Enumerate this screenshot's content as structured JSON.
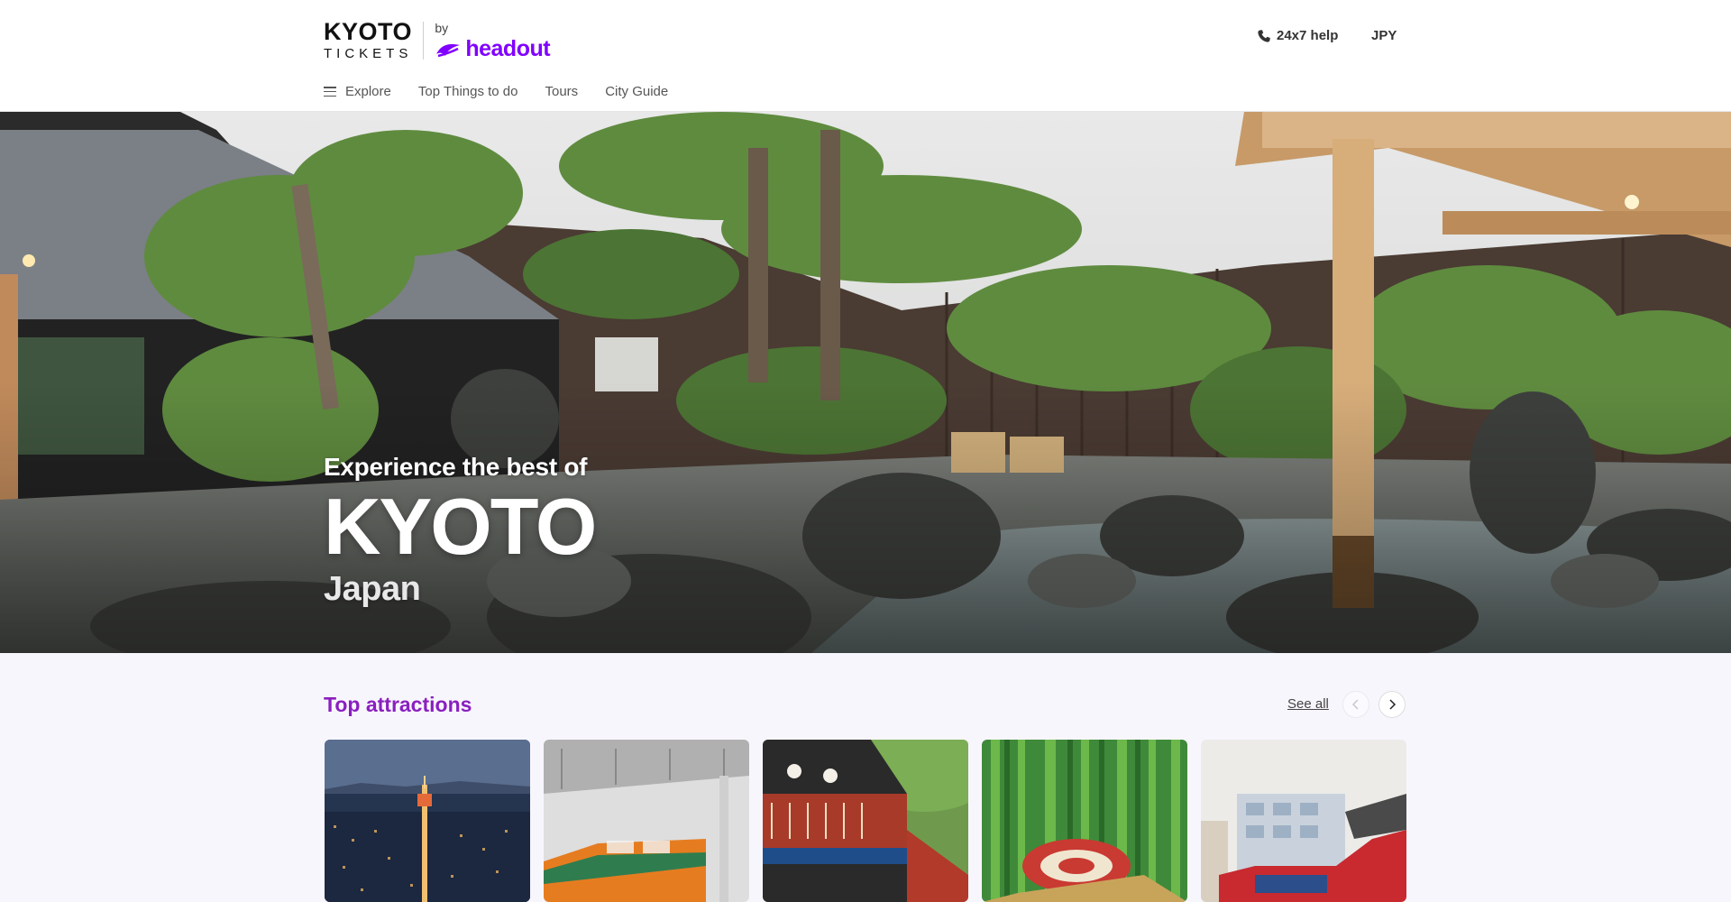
{
  "header": {
    "logo_city": "KYOTO",
    "logo_tickets": "TICKETS",
    "logo_by": "by",
    "logo_brand": "headout",
    "help_label": "24x7 help",
    "currency": "JPY"
  },
  "nav": {
    "items": [
      {
        "label": "Explore",
        "icon": "menu-icon"
      },
      {
        "label": "Top Things to do"
      },
      {
        "label": "Tours"
      },
      {
        "label": "City Guide"
      }
    ]
  },
  "hero": {
    "subtitle": "Experience the best of",
    "title": "KYOTO",
    "country": "Japan"
  },
  "attractions": {
    "title": "Top attractions",
    "see_all": "See all",
    "cards": [
      {
        "image": "kyoto-tower-night"
      },
      {
        "image": "train-station"
      },
      {
        "image": "red-building"
      },
      {
        "image": "bamboo-umbrella"
      },
      {
        "image": "sightseeing-bus"
      }
    ]
  },
  "colors": {
    "brand": "#8000ff",
    "section_title": "#8a1fc0",
    "page_bg": "#f8f6fd"
  }
}
